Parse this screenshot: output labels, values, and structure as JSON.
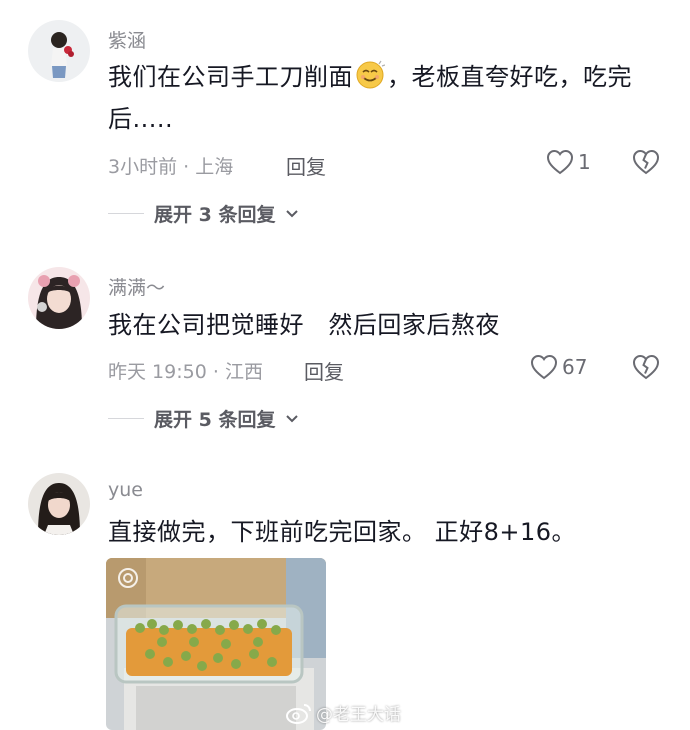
{
  "comments": [
    {
      "username": "紫涵",
      "text_before_emoji": "我们在公司手工刀削面",
      "text_after_emoji": "，老板直夸好吃，吃完后.....",
      "emoji": "smiling-face-emoji",
      "time": "3小时前",
      "location": "上海",
      "reply_label": "回复",
      "likes": "1",
      "expand_label": "展开 3 条回复"
    },
    {
      "username": "满满～",
      "text": "我在公司把觉睡好   然后回家后熬夜",
      "time": "昨天 19:50",
      "location": "江西",
      "reply_label": "回复",
      "likes": "67",
      "expand_label": "展开 5 条回复"
    },
    {
      "username": "yue",
      "text": "直接做完，下班前吃完回家。 正好8+16。",
      "image": "glass-lunchbox-with-peas-and-pumpkin"
    }
  ],
  "watermark": "@老王大话",
  "colors": {
    "text": "#161823",
    "secondary": "#8a8b91",
    "icon": "#6a6b72"
  }
}
